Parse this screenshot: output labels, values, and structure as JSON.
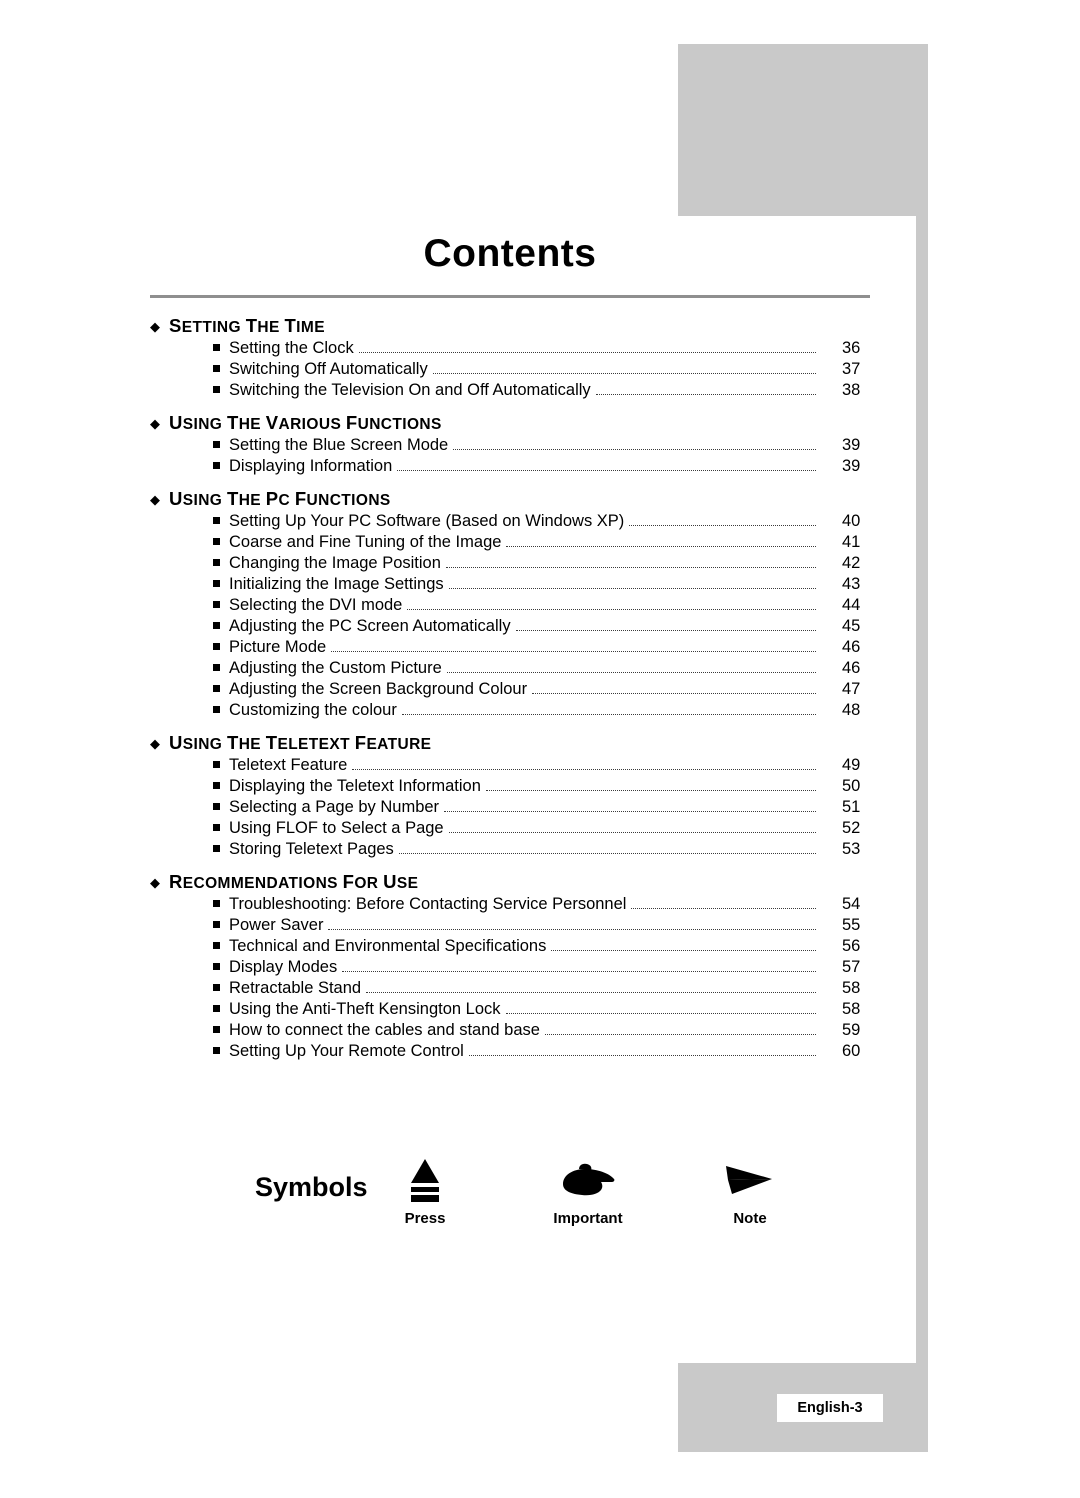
{
  "document": {
    "title": "Contents",
    "page_label": "English-3"
  },
  "sections": [
    {
      "title": "Setting the Time",
      "entries": [
        {
          "text": "Setting the Clock",
          "page": "36"
        },
        {
          "text": "Switching Off Automatically",
          "page": "37"
        },
        {
          "text": "Switching the Television On and Off Automatically",
          "page": "38"
        }
      ]
    },
    {
      "title": "Using the Various Functions",
      "entries": [
        {
          "text": "Setting the Blue Screen Mode",
          "page": "39"
        },
        {
          "text": "Displaying Information",
          "page": "39"
        }
      ]
    },
    {
      "title": "Using the PC Functions",
      "entries": [
        {
          "text": "Setting Up Your PC Software (Based on Windows XP)",
          "page": "40"
        },
        {
          "text": "Coarse and Fine Tuning of the Image",
          "page": "41"
        },
        {
          "text": "Changing the Image Position",
          "page": "42"
        },
        {
          "text": "Initializing the Image Settings",
          "page": "43"
        },
        {
          "text": "Selecting the DVI mode",
          "page": "44"
        },
        {
          "text": "Adjusting the PC Screen Automatically",
          "page": "45"
        },
        {
          "text": "Picture Mode",
          "page": "46"
        },
        {
          "text": "Adjusting the Custom Picture",
          "page": "46"
        },
        {
          "text": "Adjusting the Screen Background Colour",
          "page": "47"
        },
        {
          "text": "Customizing the colour",
          "page": "48"
        }
      ]
    },
    {
      "title": "Using the Teletext Feature",
      "entries": [
        {
          "text": "Teletext Feature",
          "page": "49"
        },
        {
          "text": "Displaying the Teletext Information",
          "page": "50"
        },
        {
          "text": "Selecting a Page by Number",
          "page": "51"
        },
        {
          "text": "Using FLOF to Select a Page",
          "page": "52"
        },
        {
          "text": "Storing Teletext Pages",
          "page": "53"
        }
      ]
    },
    {
      "title": "Recommendations For Use",
      "entries": [
        {
          "text": "Troubleshooting: Before Contacting Service Personnel",
          "page": "54"
        },
        {
          "text": "Power Saver",
          "page": "55"
        },
        {
          "text": "Technical and Environmental Specifications",
          "page": "56"
        },
        {
          "text": "Display Modes",
          "page": "57"
        },
        {
          "text": "Retractable Stand",
          "page": "58"
        },
        {
          "text": "Using the Anti-Theft Kensington Lock",
          "page": "58"
        },
        {
          "text": "How to connect the cables and stand base",
          "page": "59"
        },
        {
          "text": "Setting Up Your Remote Control",
          "page": "60"
        }
      ]
    }
  ],
  "symbols": {
    "heading": "Symbols",
    "items": [
      {
        "icon": "press-button-icon",
        "caption": "Press"
      },
      {
        "icon": "pointing-hand-icon",
        "caption": "Important"
      },
      {
        "icon": "arrow-note-icon",
        "caption": "Note"
      }
    ]
  },
  "colors": {
    "grey_block": "#c9c9c9",
    "rule": "#8f8f8f"
  }
}
